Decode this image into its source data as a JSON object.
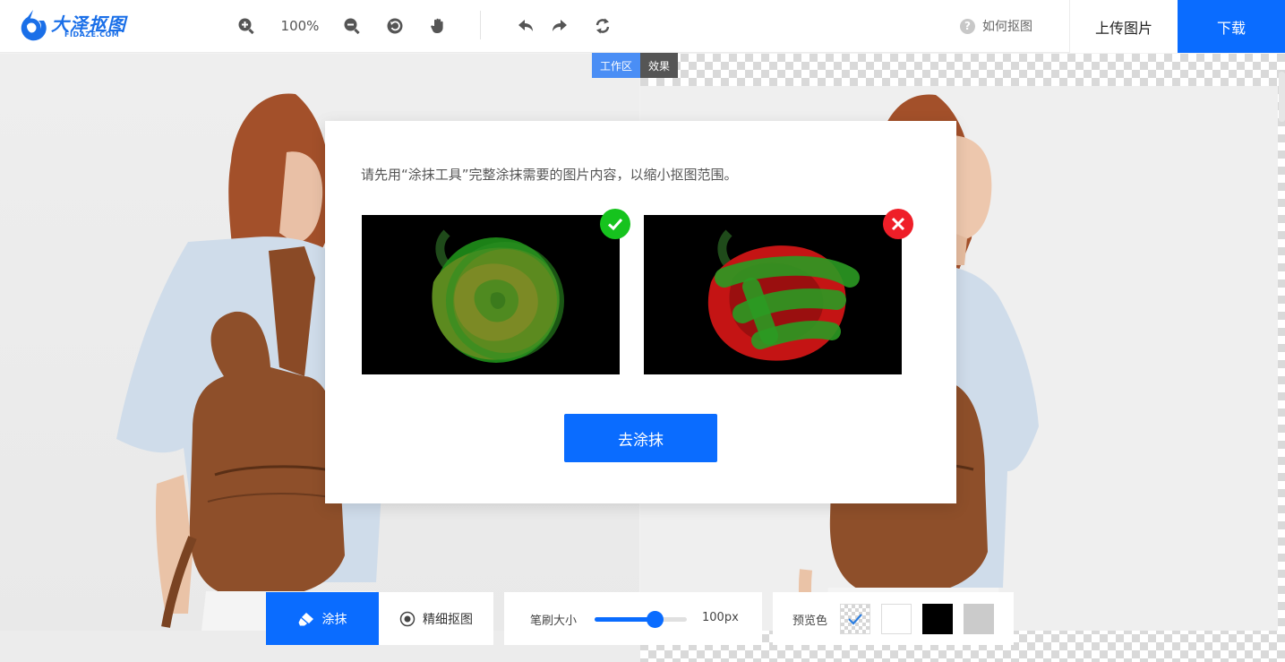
{
  "header": {
    "logo_text": "大泽抠图",
    "logo_sub": "FIDAZE.COM",
    "zoom": "100%",
    "help": "如何抠图",
    "upload": "上传图片",
    "download": "下载"
  },
  "tabs": {
    "work": "工作区",
    "effect": "效果"
  },
  "modal": {
    "instruction": "请先用“涂抹工具”完整涂抹需要的图片内容，以缩小抠图范围。",
    "confirm": "去涂抹"
  },
  "toolbar": {
    "smear": "涂抹",
    "fine": "精细抠图",
    "brush_label": "笔刷大小",
    "brush_value": "100px",
    "brush_level": 0.65,
    "preview_label": "预览色"
  },
  "colors": {
    "accent": "#0a6cff",
    "ok": "#16c31e",
    "error": "#ef1e28",
    "preview_white": "#ffffff",
    "preview_black": "#000000",
    "preview_gray": "#cbcbcb"
  }
}
